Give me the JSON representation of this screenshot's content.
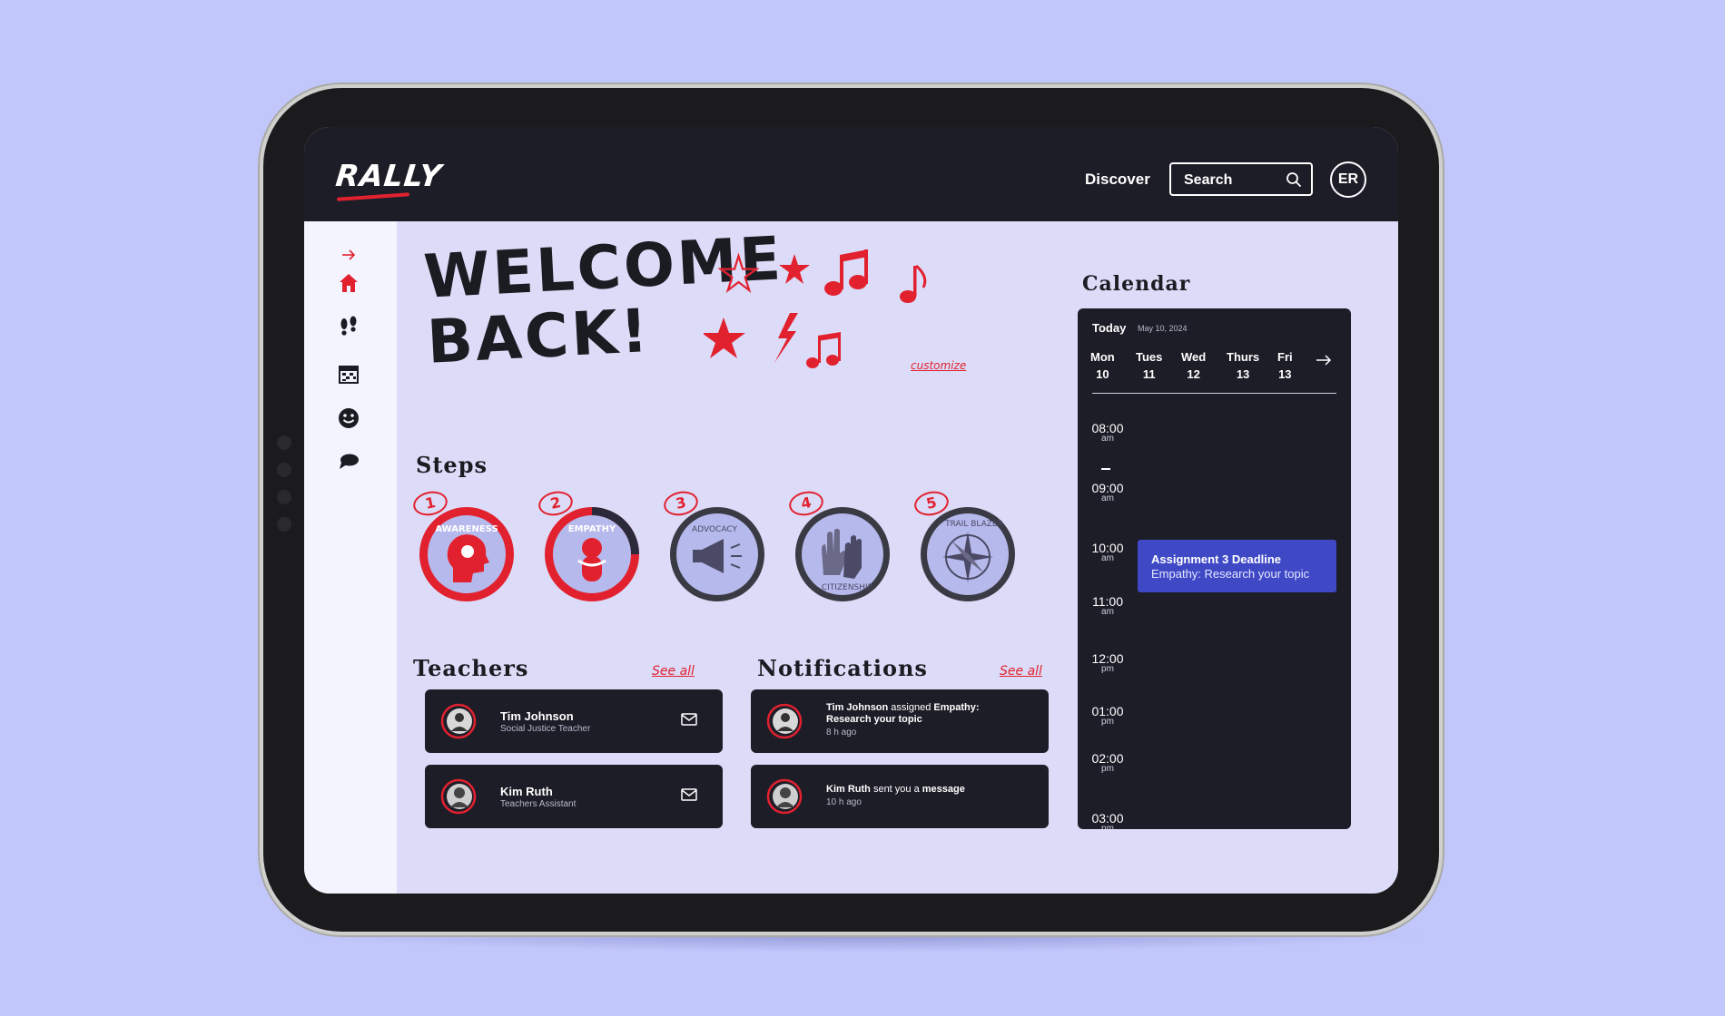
{
  "app": {
    "logo": "RALLY"
  },
  "header": {
    "discover_label": "Discover",
    "search_placeholder": "Search",
    "avatar_initials": "ER"
  },
  "sidebar": {
    "items": [
      {
        "icon": "arrow-right-icon"
      },
      {
        "icon": "home-icon"
      },
      {
        "icon": "footsteps-icon"
      },
      {
        "icon": "calendar-icon"
      },
      {
        "icon": "smiley-icon"
      },
      {
        "icon": "chat-bubble-icon"
      }
    ]
  },
  "welcome": {
    "line1": "WELCOME",
    "line2": "BACK!",
    "customize_label": "customize"
  },
  "steps": {
    "title": "Steps",
    "items": [
      {
        "number": "1",
        "label": "AWARENESS",
        "status": "completed"
      },
      {
        "number": "2",
        "label": "EMPATHY",
        "status": "in-progress",
        "progress": 0.25
      },
      {
        "number": "3",
        "label": "ADVOCACY",
        "status": "locked"
      },
      {
        "number": "4",
        "label": "CITIZENSHIP",
        "status": "locked"
      },
      {
        "number": "5",
        "label": "TRAIL BLAZER",
        "status": "locked"
      }
    ]
  },
  "teachers": {
    "title": "Teachers",
    "see_all": "See all",
    "items": [
      {
        "name": "Tim Johnson",
        "role": "Social Justice Teacher"
      },
      {
        "name": "Kim Ruth",
        "role": "Teachers Assistant"
      }
    ]
  },
  "notifications": {
    "title": "Notifications",
    "see_all": "See all",
    "items": [
      {
        "actor": "Tim Johnson",
        "verb": " assigned ",
        "object": "Empathy: Research your topic",
        "time": "8 h ago"
      },
      {
        "actor": "Kim Ruth",
        "verb": " sent you a ",
        "object": "message",
        "time": "10 h ago"
      }
    ]
  },
  "calendar": {
    "title": "Calendar",
    "today_label": "Today",
    "date": "May 10, 2024",
    "days": [
      {
        "name": "Mon",
        "num": "10"
      },
      {
        "name": "Tues",
        "num": "11"
      },
      {
        "name": "Wed",
        "num": "12"
      },
      {
        "name": "Thurs",
        "num": "13"
      },
      {
        "name": "Fri",
        "num": "13"
      }
    ],
    "times": [
      {
        "t": "08:00",
        "ap": "am"
      },
      {
        "t": "09:00",
        "ap": "am"
      },
      {
        "t": "10:00",
        "ap": "am"
      },
      {
        "t": "11:00",
        "ap": "am"
      },
      {
        "t": "12:00",
        "ap": "pm"
      },
      {
        "t": "01:00",
        "ap": "pm"
      },
      {
        "t": "02:00",
        "ap": "pm"
      },
      {
        "t": "03:00",
        "ap": "pm"
      }
    ],
    "event": {
      "title": "Assignment 3 Deadline",
      "subtitle": "Empathy: Research your topic"
    }
  },
  "colors": {
    "background": "#c2c7fb",
    "dark": "#1d1d28",
    "accent_red": "#e2212f",
    "accent_blue": "#3f49c6",
    "screen_bg": "#dcdcf8"
  }
}
